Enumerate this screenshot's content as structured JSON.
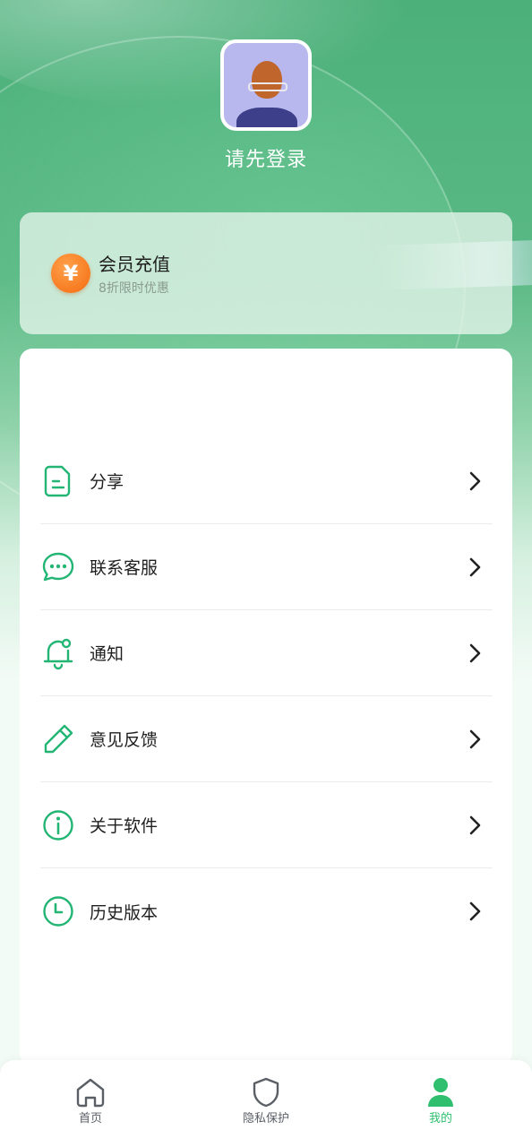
{
  "profile": {
    "login_text": "请先登录"
  },
  "vip": {
    "icon_symbol": "¥",
    "title": "会员充值",
    "subtitle": "8折限时优惠"
  },
  "menu": {
    "items": [
      {
        "label": "分享",
        "icon": "document-icon"
      },
      {
        "label": "联系客服",
        "icon": "chat-bubble-icon"
      },
      {
        "label": "通知",
        "icon": "bell-icon"
      },
      {
        "label": "意见反馈",
        "icon": "pencil-icon"
      },
      {
        "label": "关于软件",
        "icon": "info-icon"
      },
      {
        "label": "历史版本",
        "icon": "clock-icon"
      }
    ]
  },
  "tabbar": {
    "tabs": [
      {
        "label": "首页",
        "icon": "home-icon",
        "active": false
      },
      {
        "label": "隐私保护",
        "icon": "shield-icon",
        "active": false
      },
      {
        "label": "我的",
        "icon": "user-icon",
        "active": true
      }
    ]
  },
  "colors": {
    "accent": "#2fbf6e",
    "icon_green": "#22b573",
    "vip_orange": "#f46a10"
  }
}
